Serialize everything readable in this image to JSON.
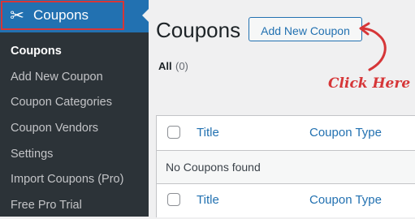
{
  "sidebar": {
    "menu_label": "Coupons",
    "menu_icon": "scissors-icon",
    "items": [
      {
        "label": "Coupons",
        "current": true
      },
      {
        "label": "Add New Coupon"
      },
      {
        "label": "Coupon Categories"
      },
      {
        "label": "Coupon Vendors"
      },
      {
        "label": "Settings"
      },
      {
        "label": "Import Coupons (Pro)"
      },
      {
        "label": "Free Pro Trial"
      }
    ]
  },
  "main": {
    "title": "Coupons",
    "add_button": "Add New Coupon",
    "filter": {
      "label": "All",
      "count": "(0)"
    },
    "table": {
      "columns": {
        "title": "Title",
        "type": "Coupon Type"
      },
      "empty_message": "No Coupons found"
    }
  },
  "annotation": {
    "text": "Click Here",
    "color": "#d63638"
  },
  "colors": {
    "sidebar_bg": "#2c3338",
    "menu_active_bg": "#2271b1",
    "highlight_border": "#d63638",
    "link": "#2271b1"
  }
}
